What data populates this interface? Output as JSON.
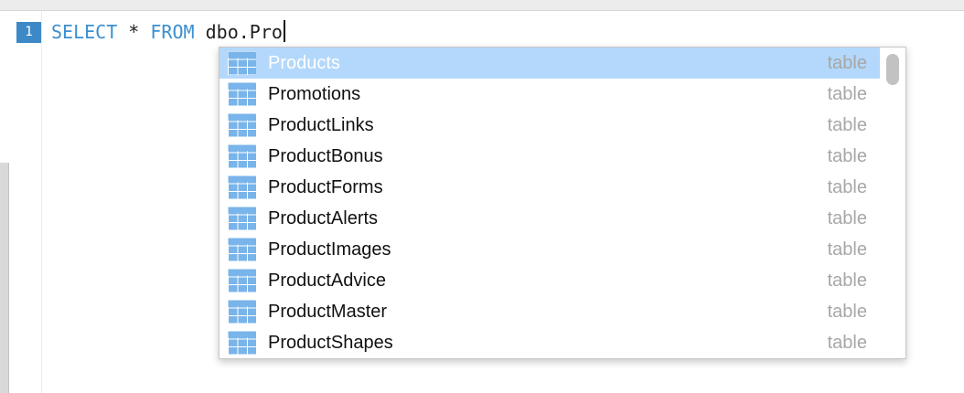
{
  "editor": {
    "line_number": "1",
    "tokens": {
      "select": "SELECT",
      "star": "*",
      "from": "FROM",
      "ident": "dbo.Pro"
    }
  },
  "autocomplete": {
    "items": [
      {
        "name": "Products",
        "type": "table",
        "selected": true
      },
      {
        "name": "Promotions",
        "type": "table"
      },
      {
        "name": "ProductLinks",
        "type": "table"
      },
      {
        "name": "ProductBonus",
        "type": "table"
      },
      {
        "name": "ProductForms",
        "type": "table"
      },
      {
        "name": "ProductAlerts",
        "type": "table"
      },
      {
        "name": "ProductImages",
        "type": "table"
      },
      {
        "name": "ProductAdvice",
        "type": "table"
      },
      {
        "name": "ProductMaster",
        "type": "table"
      },
      {
        "name": "ProductShapes",
        "type": "table"
      }
    ]
  },
  "colors": {
    "keyword": "#3b8fd0",
    "line_number_bg": "#3d89c7",
    "selection": "#b3d8fb",
    "type_text": "#a7a7a7",
    "table_icon": "#79b4ea"
  }
}
